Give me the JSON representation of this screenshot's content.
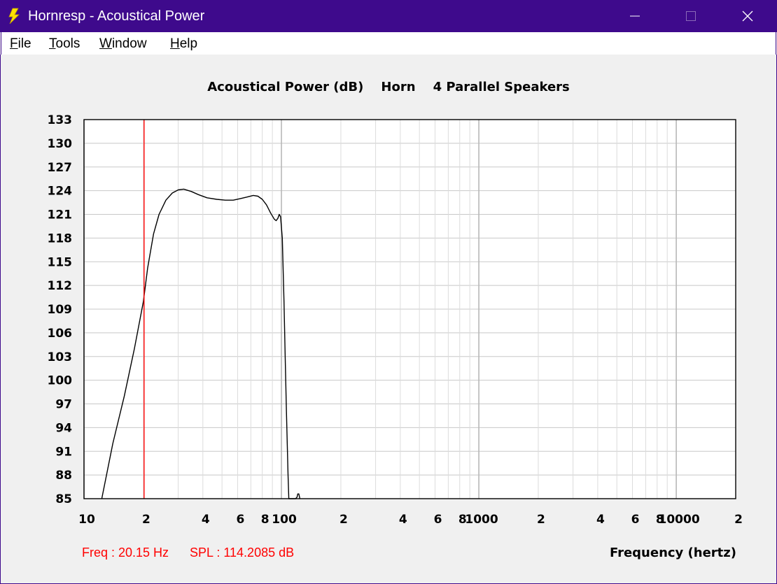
{
  "window": {
    "title": "Hornresp - Acoustical Power",
    "icon": "lightning-bolt-icon",
    "controls": [
      "minimize-icon",
      "maximize-icon",
      "close-icon"
    ]
  },
  "menu": {
    "items": [
      {
        "label": "File",
        "accel": "F",
        "rest": "ile"
      },
      {
        "label": "Tools",
        "accel": "T",
        "rest": "ools"
      },
      {
        "label": "Window",
        "accel": "W",
        "rest": "indow"
      },
      {
        "label": "Help",
        "accel": "H",
        "rest": "elp"
      }
    ]
  },
  "readout": {
    "freq": "Freq : 20.15 Hz",
    "spl": "SPL : 114.2085 dB"
  },
  "colors": {
    "titlebar": "#3e0a8c",
    "curve": "#000000",
    "cursor": "#ff0000",
    "grid": "#c8c8c8",
    "readout": "#ff0000"
  },
  "chart_data": {
    "type": "line",
    "title": "Acoustical Power (dB)    Horn    4 Parallel Speakers",
    "xlabel": "Frequency (hertz)",
    "ylabel": "",
    "xscale": "log",
    "xlim": [
      10,
      20000
    ],
    "ylim": [
      85,
      133
    ],
    "yticks": [
      133,
      130,
      127,
      124,
      121,
      118,
      115,
      112,
      109,
      106,
      103,
      100,
      97,
      94,
      91,
      88,
      85
    ],
    "xtick_labels": [
      {
        "value": 10,
        "label": "10"
      },
      {
        "value": 20,
        "label": "2"
      },
      {
        "value": 40,
        "label": "4"
      },
      {
        "value": 60,
        "label": "6"
      },
      {
        "value": 80,
        "label": "8"
      },
      {
        "value": 100,
        "label": "100"
      },
      {
        "value": 200,
        "label": "2"
      },
      {
        "value": 400,
        "label": "4"
      },
      {
        "value": 600,
        "label": "6"
      },
      {
        "value": 800,
        "label": "8"
      },
      {
        "value": 1000,
        "label": "1000"
      },
      {
        "value": 2000,
        "label": "2"
      },
      {
        "value": 4000,
        "label": "4"
      },
      {
        "value": 6000,
        "label": "6"
      },
      {
        "value": 8000,
        "label": "8"
      },
      {
        "value": 10000,
        "label": "10000"
      },
      {
        "value": 20000,
        "label": "2"
      }
    ],
    "grid": true,
    "cursor": {
      "x": 20.15,
      "y": 114.2085
    },
    "series": [
      {
        "x": [
          12.3,
          14,
          16,
          18,
          20,
          21,
          22.5,
          24,
          26,
          28,
          30,
          32,
          35,
          38,
          42,
          47,
          52,
          57,
          62,
          67,
          72,
          76,
          80,
          84,
          88,
          92,
          94,
          96,
          97.5,
          99,
          101,
          103,
          104.5,
          106,
          108,
          109,
          110,
          111,
          112,
          113,
          114,
          115,
          116,
          118,
          120,
          121,
          122.5,
          124
        ],
        "y": [
          85,
          92,
          98,
          104,
          110,
          114.2,
          118.5,
          121,
          122.8,
          123.7,
          124.1,
          124.2,
          123.9,
          123.5,
          123.1,
          122.9,
          122.8,
          122.8,
          123,
          123.2,
          123.4,
          123.3,
          122.9,
          122.2,
          121.2,
          120.4,
          120.2,
          120.5,
          121,
          120.7,
          118,
          110,
          103,
          96,
          88,
          85,
          85,
          85,
          85,
          85,
          85,
          85,
          85,
          85,
          85.2,
          85.6,
          85.6,
          85
        ]
      }
    ]
  }
}
